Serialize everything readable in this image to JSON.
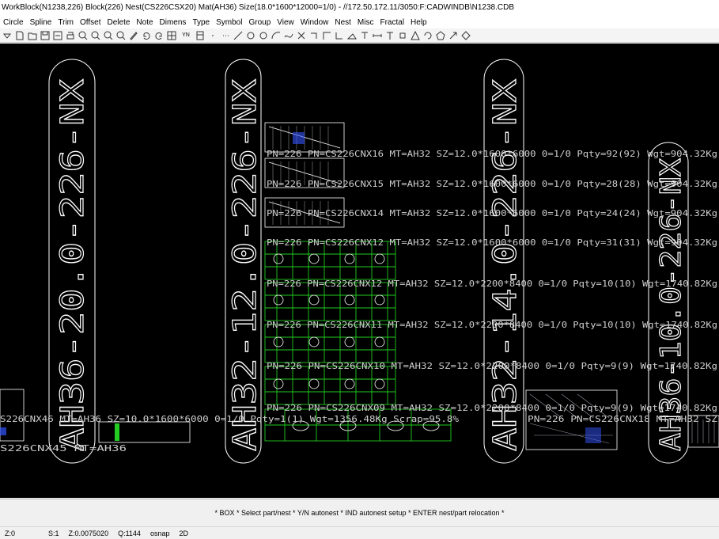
{
  "window": {
    "title": "WorkBlock(N1238,226) Block(226) Nest(CS226CSX20) Mat(AH36) Size(18.0*1600*12000=1/0) - //172.50.172.11/3050:F:CADWINDB\\N1238.CDB"
  },
  "menu": [
    "Circle",
    "Spline",
    "Trim",
    "Offset",
    "Delete",
    "Note",
    "Dimens",
    "Type",
    "Symbol",
    "Group",
    "View",
    "Window",
    "Nest",
    "Misc",
    "Fractal",
    "Help"
  ],
  "toolbar": {
    "icons": [
      "dropdown-icon",
      "new-file-icon",
      "open-folder-icon",
      "save-icon",
      "save-all-icon",
      "print-icon",
      "zoom-in-icon",
      "zoom-out-icon",
      "zoom-window-icon",
      "zoom-previous-icon",
      "pencil-icon",
      "undo-icon",
      "redo-icon",
      "grid-icon",
      "yn-icon",
      "layer-icon",
      "dot-icon",
      "dots-icon",
      "line-icon",
      "circle-icon",
      "circle-outline-icon",
      "arc-icon",
      "spline-icon",
      "trim-icon",
      "offset-icon",
      "perpendicular-icon",
      "corner-icon",
      "fill-icon",
      "note-icon",
      "dimension-icon",
      "text-icon",
      "symbol-icon",
      "triangle-icon",
      "rotate-icon",
      "polygon-icon",
      "arrow-icon",
      "diamond-icon"
    ],
    "yn_label": "YN"
  },
  "canvas": {
    "vertical_labels": [
      "AH36-20.0-226-NX",
      "AH32-12.0-226-NX",
      "AH32-14.0-226-NX",
      "AH36-10.0-226-NX"
    ],
    "nest_rows": [
      "PN=226 PN=CS226CNX16 MT=AH32 SZ=12.0*1600*6000 0=1/0 Pqty=92(92) Wgt=904.32Kg",
      "PN=226 PN=CS226CNX15 MT=AH32 SZ=12.0*1600*6000 0=1/0 Pqty=28(28) Wgt=904.32Kg",
      "PN=226 PN=CS226CNX14 MT=AH32 SZ=12.0*1600*6000 0=1/0 Pqty=24(24) Wgt=904.32Kg",
      "PN=226 PN=CS226CNX12 MT=AH32 SZ=12.0*1600*6000 0=1/0 Pqty=31(31) Wgt=904.32Kg",
      "PN=226 PN=CS226CNX12 MT=AH32 SZ=12.0*2200*8400 0=1/0 Pqty=10(10) Wgt=1740.82Kg",
      "PN=226 PN=CS226CNX11 MT=AH32 SZ=12.0*2200*8400 0=1/0 Pqty=10(10) Wgt=1740.82Kg",
      "PN=226 PN=CS226CNX10 MT=AH32 SZ=12.0*2200*8400 0=1/0 Pqty=9(9) Wgt=1740.82Kg",
      "PN=226 PN=CS226CNX09 MT=AH32 SZ=12.0*2200*8400 0=1/0 Pqty=9(9) Wgt=1740.82Kg"
    ],
    "left_rows": [
      "S226CNX46 MT=AH36 SZ=10.0*1600*6000 0=1/0 Pqty=1(1) Wgt=1356.48Kg Scrap=95.8%",
      "S226CNX45 MT=AH36"
    ],
    "right_rows": [
      "PN=226 PN=CS226CNX18 MT=AH32 SZ"
    ]
  },
  "command": {
    "prompt": "* BOX * Select part/nest * Y/N autonest * IND autonest setup * ENTER nest/part relocation *"
  },
  "status": {
    "coord": "Z:0",
    "scale": "S:1",
    "zoom": "Z:0.0075020",
    "count": "Q:1144",
    "snap": "osnap",
    "mode": "2D"
  }
}
